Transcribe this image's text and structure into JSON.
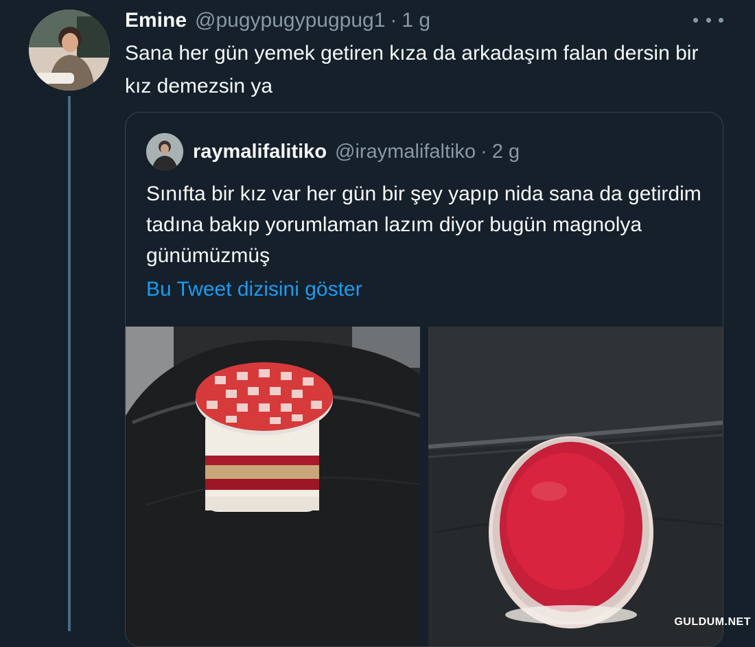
{
  "tweet": {
    "display_name": "Emine",
    "handle": "@pugypugypugpug1",
    "separator": "·",
    "time": "1 g",
    "text": "Sana her gün yemek getiren kıza da arkadaşım falan dersin bir kız demezsin ya",
    "avatar_icon": "user-avatar",
    "more_icon": "more-horizontal-icon"
  },
  "quoted": {
    "display_name": "raymalifalitiko",
    "handle": "@iraymalifaltiko",
    "separator": "·",
    "time": "2 g",
    "text": "Sınıfta bir kız var her gün bir şey yapıp nida sana da getirdim tadına bakıp yorumlaman lazım diyor bugün magnolya günümüzmüş",
    "show_thread": "Bu Tweet dizisini göster",
    "photos": [
      "magnolia-jar-photo",
      "jar-top-view-photo"
    ]
  },
  "watermark": "GULDUM.NET",
  "colors": {
    "background": "#15202b",
    "accent_link": "#1d9bf0",
    "muted_text": "#8899a6",
    "border": "#38444d"
  }
}
